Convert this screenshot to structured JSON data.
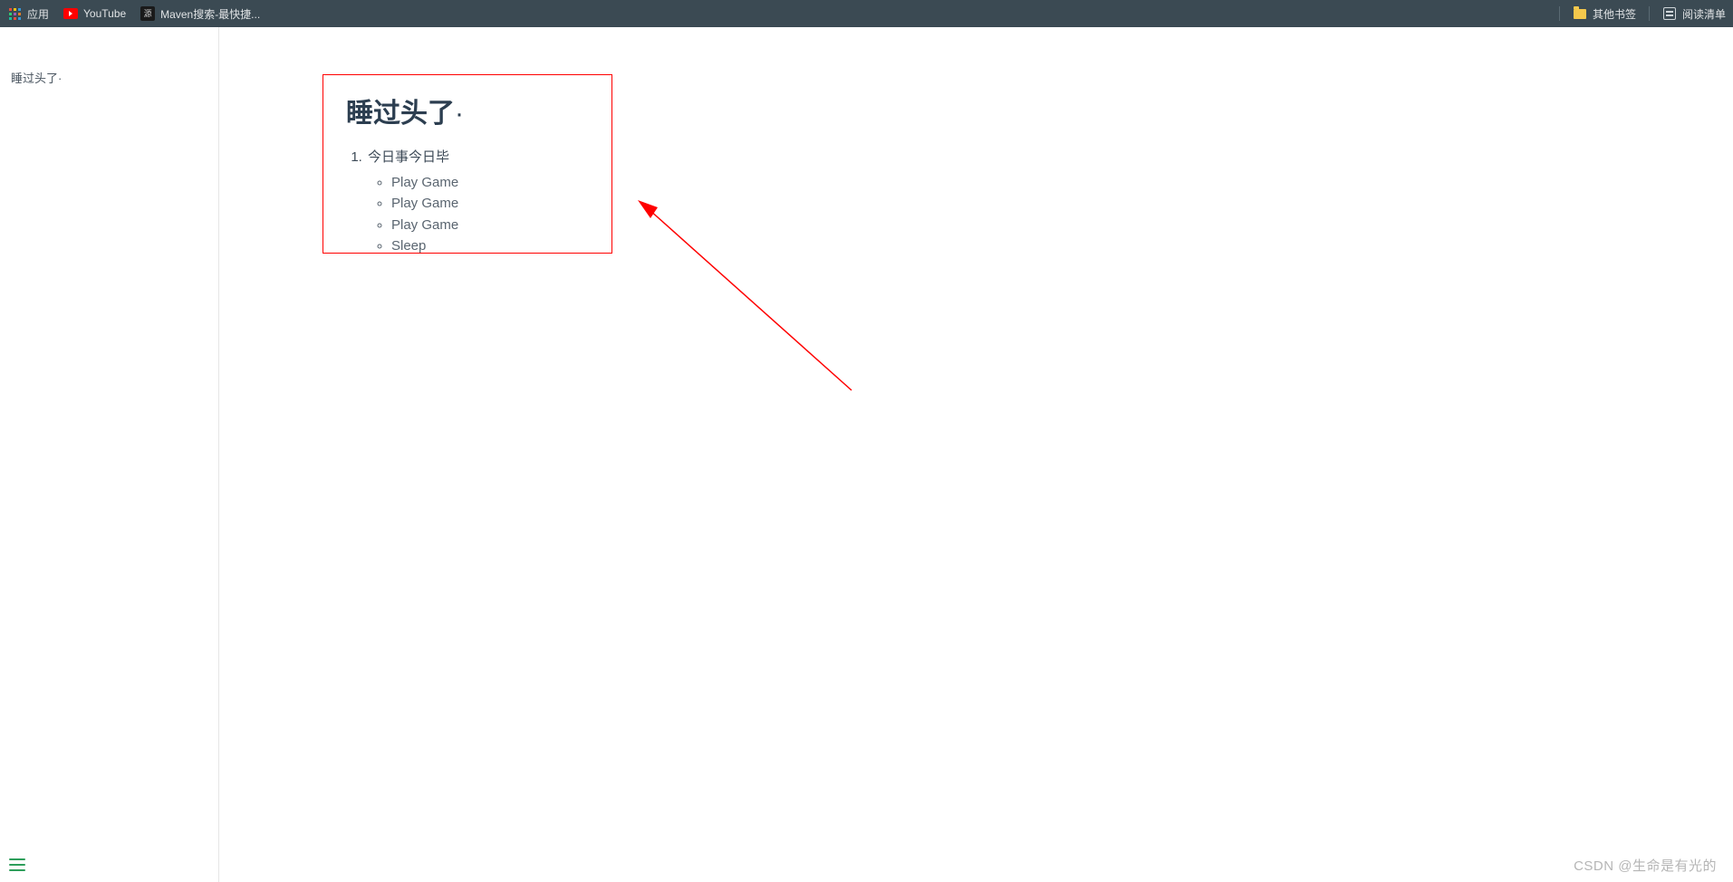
{
  "bookmarks_bar": {
    "apps_label": "应用",
    "items": [
      {
        "label": "YouTube",
        "icon": "youtube-icon"
      },
      {
        "label": "Maven搜索-最快捷...",
        "icon": "maven-icon"
      }
    ],
    "right": {
      "other_bookmarks": "其他书签",
      "reading_list": "阅读清单"
    }
  },
  "sidebar": {
    "outline_title": "睡过头了·"
  },
  "document": {
    "title": "睡过头了",
    "title_suffix": "·",
    "ordered_item_label": "今日事今日毕",
    "sub_items": [
      "Play Game",
      "Play Game",
      "Play Game",
      "Sleep"
    ]
  },
  "watermark": "CSDN @生命是有光的"
}
